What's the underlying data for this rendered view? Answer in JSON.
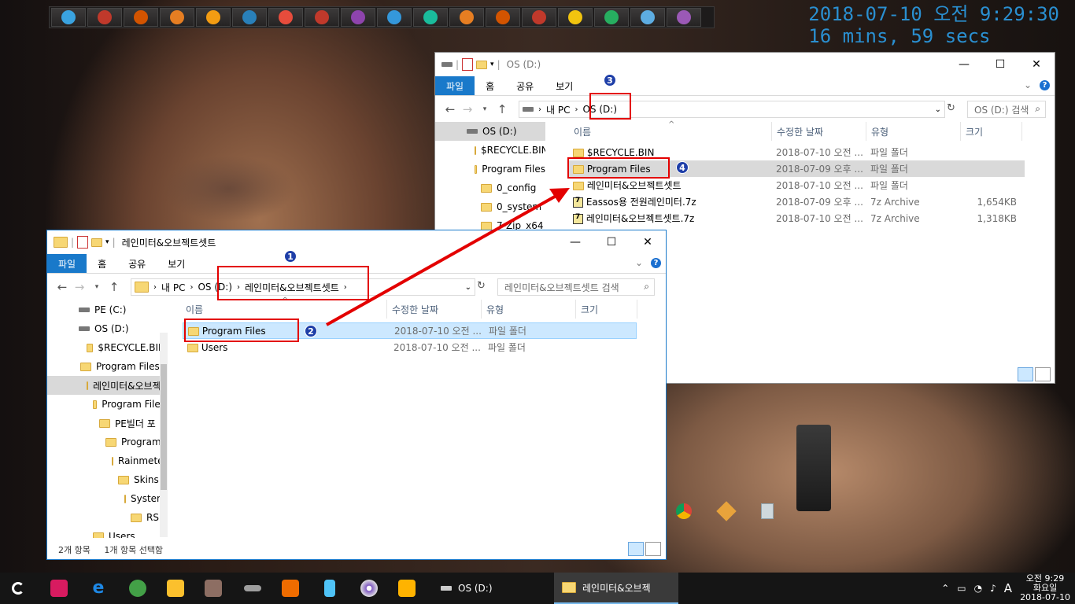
{
  "clock": {
    "line1": "2018-07-10 오전 9:29:30",
    "line2": "16 mins, 59 secs"
  },
  "launcher": [
    "#3aa3e0",
    "#c0392b",
    "#d35400",
    "#e67e22",
    "#f39c12",
    "#2980b9",
    "#e74c3c",
    "#c0392b",
    "#8e44ad",
    "#3498db",
    "#1abc9c",
    "#e67e22",
    "#d35400",
    "#c0392b",
    "#f1c40f",
    "#27ae60",
    "#5dade2",
    "#9b59b6"
  ],
  "win_back": {
    "title": "OS (D:)",
    "tabs": [
      "파일",
      "홈",
      "공유",
      "보기"
    ],
    "address": {
      "pc": "내 PC",
      "drive": "OS (D:)"
    },
    "search_placeholder": "OS (D:) 검색",
    "tree": [
      "OS (D:)",
      "$RECYCLE.BIN",
      "Program Files",
      "0_config",
      "0_system",
      "7-Zip_x64"
    ],
    "columns": {
      "name": "이름",
      "date": "수정한 날짜",
      "type": "유형",
      "size": "크기"
    },
    "rows": [
      {
        "name": "$RECYCLE.BIN",
        "date": "2018-07-10 오전 ...",
        "type": "파일 폴더",
        "size": "",
        "icon": "folder"
      },
      {
        "name": "Program Files",
        "date": "2018-07-09 오후 ...",
        "type": "파일 폴더",
        "size": "",
        "icon": "folder"
      },
      {
        "name": "레인미터&오브젝트셋트",
        "date": "2018-07-10 오전 ...",
        "type": "파일 폴더",
        "size": "",
        "icon": "folder"
      },
      {
        "name": "Eassos용 전원레인미터.7z",
        "date": "2018-07-09 오후 ...",
        "type": "7z Archive",
        "size": "1,654KB",
        "icon": "archive"
      },
      {
        "name": "레인미터&오브젝트셋트.7z",
        "date": "2018-07-10 오전 ...",
        "type": "7z Archive",
        "size": "1,318KB",
        "icon": "archive"
      }
    ]
  },
  "win_front": {
    "title": "레인미터&오브젝트셋트",
    "tabs": [
      "파일",
      "홈",
      "공유",
      "보기"
    ],
    "address": {
      "pc": "내 PC",
      "drive": "OS (D:)",
      "folder": "레인미터&오브젝트셋트"
    },
    "search_placeholder": "레인미터&오브젝트셋트 검색",
    "tree": [
      "PE (C:)",
      "OS (D:)",
      "$RECYCLE.BIN",
      "Program Files",
      "레인미터&오브젝트셋트",
      "Program Files",
      "PE빌더 포",
      "Program",
      "Rainmeter",
      "Skins",
      "System",
      "RS",
      "Users"
    ],
    "columns": {
      "name": "이름",
      "date": "수정한 날짜",
      "type": "유형",
      "size": "크기"
    },
    "rows": [
      {
        "name": "Program Files",
        "date": "2018-07-10 오전 ...",
        "type": "파일 폴더"
      },
      {
        "name": "Users",
        "date": "2018-07-10 오전 ...",
        "type": "파일 폴더"
      }
    ],
    "status_count": "2개 항목",
    "status_selected": "1개 항목 선택함"
  },
  "annotations": [
    "1",
    "2",
    "3",
    "4"
  ],
  "taskbar": {
    "task1": "OS (D:)",
    "task2": "레인미터&오브젝",
    "tray_lang": "A",
    "time": "오전 9:29",
    "day": "화요일",
    "date": "2018-07-10"
  }
}
